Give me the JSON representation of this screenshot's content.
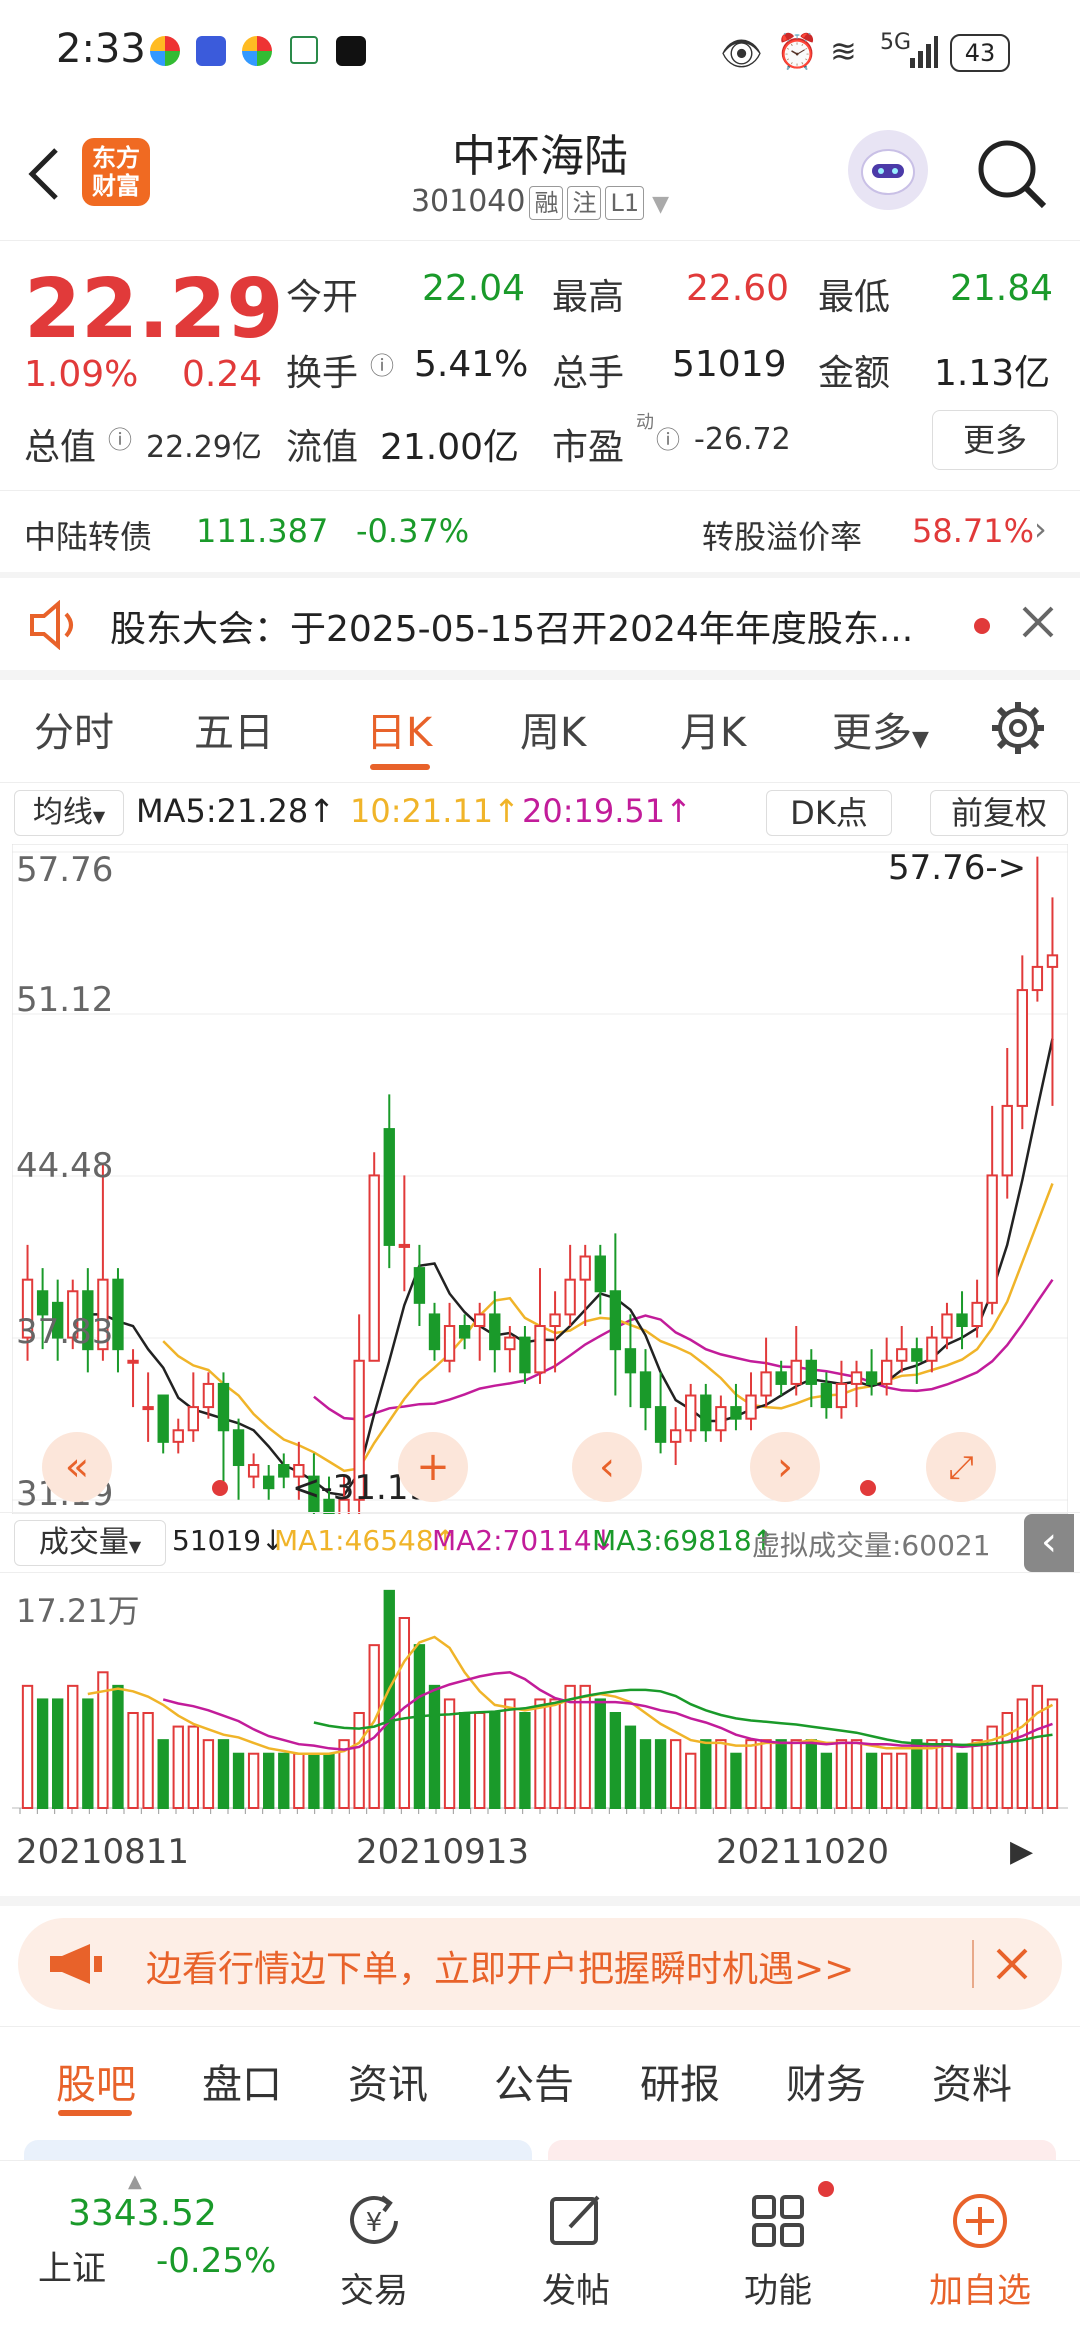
{
  "status_bar": {
    "time": "2:33",
    "battery": "43",
    "network": "5G"
  },
  "header": {
    "logo_text": "东方\n财富",
    "stock_name": "中环海陆",
    "stock_code": "301040",
    "tags": [
      "融",
      "注",
      "L1"
    ]
  },
  "quote": {
    "price": "22.29",
    "change_pct": "1.09%",
    "change": "0.24",
    "open_label": "今开",
    "open": "22.04",
    "high_label": "最高",
    "high": "22.60",
    "low_label": "最低",
    "low": "21.84",
    "turnover_label": "换手",
    "turnover": "5.41%",
    "volume_label": "总手",
    "volume": "51019",
    "amount_label": "金额",
    "amount": "1.13亿",
    "mktcap_label": "总值",
    "mktcap": "22.29亿",
    "float_label": "流值",
    "float_cap": "21.00亿",
    "pe_label": "市盈",
    "pe_sup": "动",
    "pe": "-26.72",
    "more_label": "更多"
  },
  "bond": {
    "name": "中陆转债",
    "price": "111.387",
    "change": "-0.37%",
    "premium_label": "转股溢价率",
    "premium": "58.71%"
  },
  "notice": {
    "text": "股东大会：于2025-05-15召开2024年年度股东..."
  },
  "chart_tabs": [
    "分时",
    "五日",
    "日K",
    "周K",
    "月K",
    "更多"
  ],
  "active_chart_tab": "日K",
  "ma_bar": {
    "selector": "均线",
    "ma5": "MA5:21.28↑",
    "ma10": "10:21.11↑",
    "ma20": "20:19.51↑",
    "dk_label": "DK点",
    "fq_label": "前复权"
  },
  "kline": {
    "y_labels": [
      "57.76",
      "51.12",
      "44.48",
      "37.83",
      "31.19"
    ],
    "max_marker": "57.76->",
    "min_marker": "<-31.19"
  },
  "volume_bar": {
    "selector": "成交量",
    "vol": "51019↓",
    "ma1": "MA1:46548↑",
    "ma2": "MA2:70114↓",
    "ma3": "MA3:69818↑",
    "virtual": "虚拟成交量:60021",
    "y_top": "17.21万"
  },
  "x_dates": [
    "20210811",
    "20210913",
    "20211020"
  ],
  "banner": {
    "text": "边看行情边下单，立即开户把握瞬时机遇>>"
  },
  "bottom_tabs": [
    "股吧",
    "盘口",
    "资讯",
    "公告",
    "研报",
    "财务",
    "资料"
  ],
  "active_bottom_tab": "股吧",
  "dock": {
    "index_value": "3343.52",
    "index_name": "上证",
    "index_change": "-0.25%",
    "items": [
      "交易",
      "发帖",
      "功能",
      "加自选"
    ]
  },
  "colors": {
    "up": "#e13a3a",
    "down": "#1a9a2a",
    "accent": "#e8622a"
  },
  "chart_data": {
    "type": "candlestick",
    "price_axis": [
      31.19,
      57.76
    ],
    "candles": [
      [
        37.0,
        39.5,
        36.0,
        41.0
      ],
      [
        39.0,
        38.0,
        36.5,
        40.0
      ],
      [
        38.5,
        37.0,
        36.0,
        39.5
      ],
      [
        37.0,
        39.0,
        36.5,
        39.5
      ],
      [
        39.0,
        36.5,
        35.5,
        40.0
      ],
      [
        36.5,
        39.5,
        36.0,
        44.5
      ],
      [
        39.5,
        36.5,
        35.5,
        40.0
      ],
      [
        36.0,
        36.0,
        34.0,
        36.5
      ],
      [
        34.0,
        34.0,
        32.5,
        35.5
      ],
      [
        34.5,
        32.5,
        32.0,
        34.5
      ],
      [
        32.5,
        33.0,
        32.0,
        33.5
      ],
      [
        33.0,
        34.0,
        32.5,
        35.5
      ],
      [
        34.0,
        35.0,
        33.5,
        35.5
      ],
      [
        35.0,
        33.0,
        30.5,
        35.5
      ],
      [
        33.0,
        31.5,
        30.0,
        33.5
      ],
      [
        31.0,
        31.5,
        30.5,
        32.0
      ],
      [
        31.0,
        30.5,
        30.0,
        31.5
      ],
      [
        31.5,
        31.0,
        30.5,
        32.0
      ],
      [
        31.0,
        31.5,
        30.0,
        32.5
      ],
      [
        31.0,
        29.5,
        29.0,
        32.0
      ],
      [
        30.0,
        29.0,
        29.0,
        31.0
      ],
      [
        29.0,
        30.0,
        28.5,
        31.0
      ],
      [
        30.0,
        36.0,
        29.0,
        38.0
      ],
      [
        36.0,
        44.0,
        36.0,
        45.0
      ],
      [
        46.0,
        41.0,
        40.0,
        47.5
      ],
      [
        41.0,
        41.0,
        39.0,
        44.0
      ],
      [
        40.0,
        38.5,
        37.5,
        41.0
      ],
      [
        38.0,
        36.5,
        36.0,
        38.5
      ],
      [
        36.0,
        37.5,
        35.5,
        38.5
      ],
      [
        37.5,
        37.0,
        36.5,
        38.0
      ],
      [
        37.5,
        38.0,
        36.0,
        38.5
      ],
      [
        38.0,
        36.5,
        35.5,
        39.0
      ],
      [
        36.5,
        37.0,
        35.5,
        37.5
      ],
      [
        37.0,
        35.5,
        35.0,
        37.5
      ],
      [
        35.5,
        37.5,
        35.0,
        40.0
      ],
      [
        37.5,
        38.0,
        35.5,
        39.0
      ],
      [
        38.0,
        39.5,
        37.5,
        41.0
      ],
      [
        39.5,
        40.5,
        37.5,
        41.0
      ],
      [
        40.5,
        39.0,
        38.0,
        41.0
      ],
      [
        39.0,
        36.5,
        34.5,
        41.5
      ],
      [
        36.5,
        35.5,
        34.0,
        38.0
      ],
      [
        35.5,
        34.0,
        33.0,
        36.5
      ],
      [
        34.0,
        32.5,
        32.0,
        35.5
      ],
      [
        32.5,
        33.0,
        31.5,
        34.0
      ],
      [
        33.0,
        34.5,
        32.5,
        35.0
      ],
      [
        34.5,
        33.0,
        32.5,
        35.0
      ],
      [
        33.0,
        34.0,
        32.5,
        34.5
      ],
      [
        34.0,
        33.5,
        33.0,
        35.0
      ],
      [
        33.5,
        34.5,
        33.0,
        35.5
      ],
      [
        34.5,
        35.5,
        34.0,
        37.0
      ],
      [
        35.5,
        35.0,
        34.5,
        36.0
      ],
      [
        35.0,
        36.0,
        34.5,
        37.5
      ],
      [
        36.0,
        35.0,
        34.0,
        36.5
      ],
      [
        35.0,
        34.0,
        33.5,
        35.5
      ],
      [
        34.0,
        35.0,
        33.5,
        36.0
      ],
      [
        35.0,
        35.5,
        34.0,
        36.0
      ],
      [
        35.5,
        35.0,
        34.5,
        36.5
      ],
      [
        35.0,
        36.0,
        34.5,
        37.0
      ],
      [
        36.0,
        36.5,
        35.5,
        37.5
      ],
      [
        36.5,
        36.0,
        35.0,
        37.0
      ],
      [
        36.0,
        37.0,
        35.5,
        37.5
      ],
      [
        37.0,
        38.0,
        36.5,
        38.5
      ],
      [
        38.0,
        37.5,
        36.5,
        39.0
      ],
      [
        37.5,
        38.5,
        37.0,
        39.5
      ],
      [
        38.5,
        44.0,
        38.0,
        47.0
      ],
      [
        44.0,
        47.0,
        43.0,
        49.5
      ],
      [
        47.0,
        52.0,
        46.0,
        53.5
      ],
      [
        52.0,
        53.0,
        51.5,
        57.76
      ],
      [
        53.0,
        53.5,
        47.0,
        56.0
      ]
    ],
    "volumes": [
      9,
      8,
      8,
      9,
      8,
      10,
      9,
      7,
      7,
      5,
      6,
      6,
      5,
      5,
      4,
      4,
      4,
      4,
      4,
      4,
      4,
      5,
      7,
      12,
      16,
      14,
      12,
      9,
      8,
      7,
      7,
      7,
      8,
      7,
      8,
      8,
      9,
      9,
      8,
      7,
      6,
      5,
      5,
      5,
      4,
      5,
      5,
      4,
      5,
      5,
      5,
      5,
      5,
      4,
      5,
      5,
      4,
      4,
      4,
      5,
      5,
      5,
      4,
      5,
      6,
      7,
      8,
      9,
      8
    ]
  }
}
